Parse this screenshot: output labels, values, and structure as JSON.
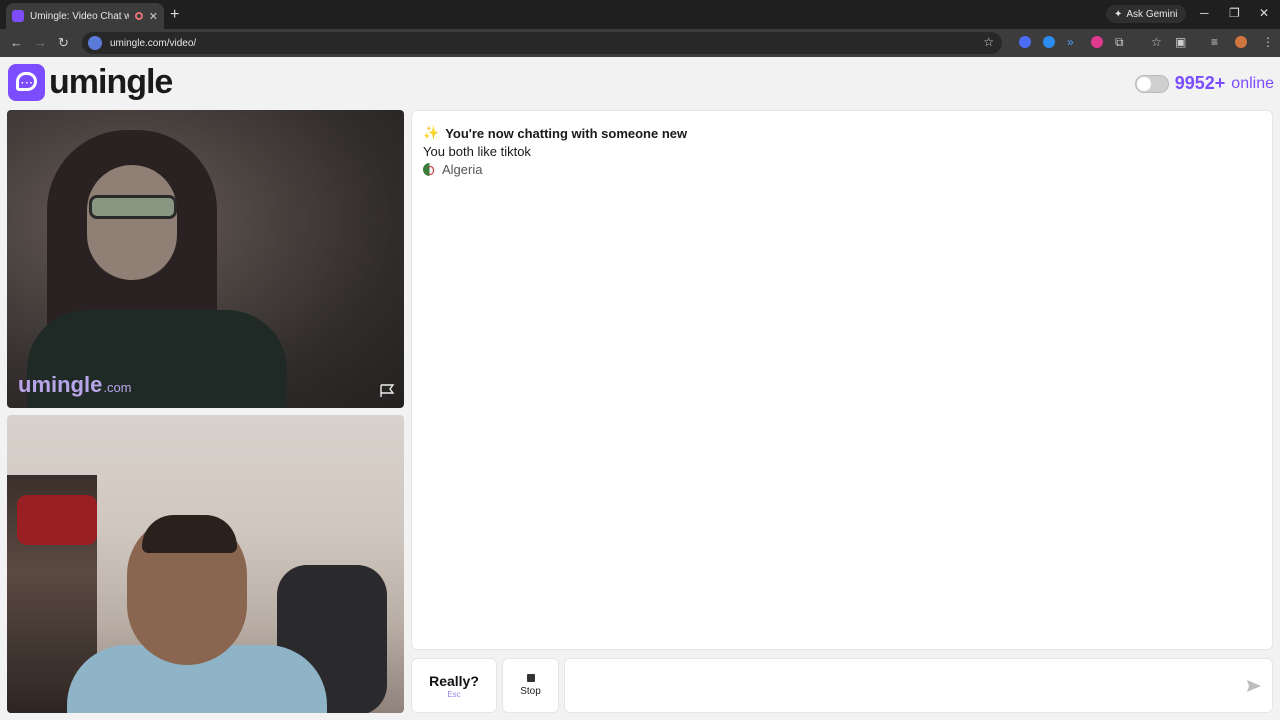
{
  "browser": {
    "tab_title": "Umingle: Video Chat with S",
    "url": "umingle.com/video/",
    "ask_gemini": "Ask Gemini"
  },
  "header": {
    "logo_text": "umingle",
    "online_count": "9952+",
    "online_label": "online"
  },
  "video": {
    "watermark_main": "umingle",
    "watermark_suffix": ".com"
  },
  "chat": {
    "system_title": "You're now chatting with someone new",
    "common_interest": "You both like tiktok",
    "country": "Algeria"
  },
  "controls": {
    "really_label": "Really?",
    "really_hint": "Esc",
    "stop_label": "Stop",
    "message_placeholder": ""
  },
  "colors": {
    "brand": "#7c4dff"
  }
}
